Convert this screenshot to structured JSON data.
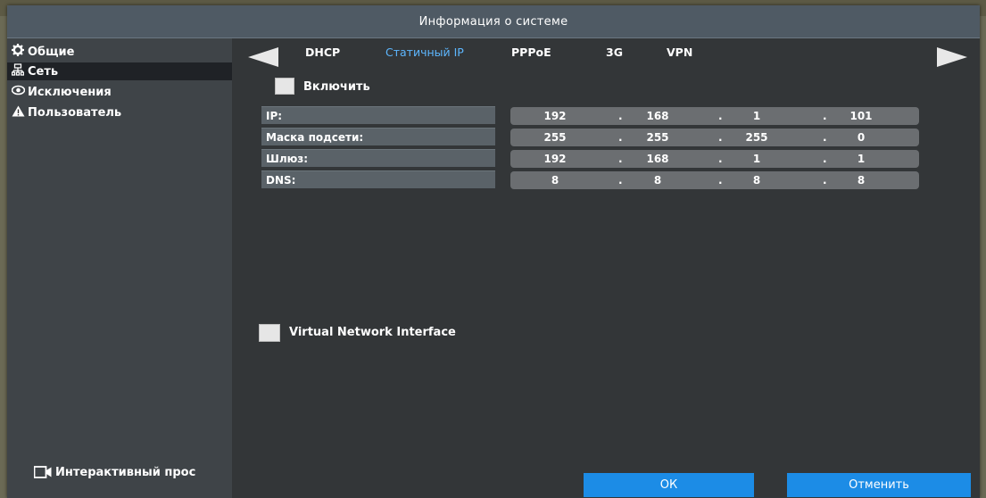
{
  "window": {
    "title": "Информация о системе"
  },
  "sidebar": {
    "items": [
      {
        "label": "Общие",
        "icon": "gear-icon"
      },
      {
        "label": "Сеть",
        "icon": "network-icon",
        "active": true
      },
      {
        "label": "Исключения",
        "icon": "eye-icon"
      },
      {
        "label": "Пользователь",
        "icon": "warning-icon"
      }
    ],
    "live_label": "Интерактивный прос"
  },
  "tabs": [
    {
      "label": "DHCP"
    },
    {
      "label": "Статичный IP",
      "active": true
    },
    {
      "label": "PPPoE"
    },
    {
      "label": "3G"
    },
    {
      "label": "VPN"
    }
  ],
  "enable": {
    "label": "Включить",
    "checked": false
  },
  "fields": [
    {
      "label": "IP:",
      "octets": [
        "192",
        "168",
        "1",
        "101"
      ]
    },
    {
      "label": "Маска подсети:",
      "octets": [
        "255",
        "255",
        "255",
        "0"
      ]
    },
    {
      "label": "Шлюз:",
      "octets": [
        "192",
        "168",
        "1",
        "1"
      ]
    },
    {
      "label": "DNS:",
      "octets": [
        "8",
        "8",
        "8",
        "8"
      ]
    }
  ],
  "vni": {
    "label": "Virtual Network Interface",
    "checked": false
  },
  "buttons": {
    "ok": "ОК",
    "cancel": "Отменить"
  },
  "colors": {
    "accent": "#1c8ce6",
    "active_tab": "#5db7ff",
    "title_bar": "#4f5a64"
  }
}
